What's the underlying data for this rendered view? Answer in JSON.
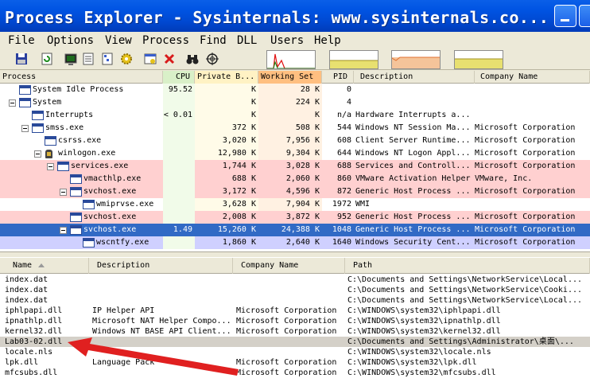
{
  "window": {
    "title": "Process Explorer - Sysinternals: www.sysinternals.co..."
  },
  "menu": [
    "File",
    "Options",
    "View",
    "Process",
    "Find",
    "DLL",
    "Users",
    "Help"
  ],
  "toolbar": {
    "icons": [
      "save-icon",
      "refresh-icon",
      "system-info-icon",
      "properties-icon",
      "tree-icon",
      "gear-icon",
      "window-target-icon",
      "kill-icon",
      "binoculars-icon",
      "crosshair-icon"
    ]
  },
  "process_list": {
    "columns": [
      "Process",
      "CPU",
      "Private B...",
      "Working Set",
      "PID",
      "Description",
      "Company Name"
    ],
    "rows": [
      {
        "name": "System Idle Process",
        "cpu": "95.52",
        "private": "K",
        "working": "28 K",
        "pid": "0",
        "desc": "",
        "company": "",
        "indent": 0,
        "tree": false,
        "bg": "#ffffff",
        "color": "#000000"
      },
      {
        "name": "System",
        "cpu": "",
        "private": "K",
        "working": "224 K",
        "pid": "4",
        "desc": "",
        "company": "",
        "indent": 0,
        "tree": true,
        "bg": "#ffffff",
        "color": "#000000"
      },
      {
        "name": "Interrupts",
        "cpu": "< 0.01",
        "private": "K",
        "working": "K",
        "pid": "n/a",
        "desc": "Hardware Interrupts a...",
        "company": "",
        "indent": 1,
        "tree": false,
        "bg": "#ffffff",
        "color": "#000000"
      },
      {
        "name": "smss.exe",
        "cpu": "",
        "private": "372 K",
        "working": "508 K",
        "pid": "544",
        "desc": "Windows NT Session Ma...",
        "company": "Microsoft Corporation",
        "indent": 1,
        "tree": true,
        "bg": "#ffffff",
        "color": "#000000"
      },
      {
        "name": "csrss.exe",
        "cpu": "",
        "private": "3,020 K",
        "working": "7,956 K",
        "pid": "608",
        "desc": "Client Server Runtime...",
        "company": "Microsoft Corporation",
        "indent": 2,
        "tree": false,
        "bg": "#ffffff",
        "color": "#000000"
      },
      {
        "name": "winlogon.exe",
        "cpu": "",
        "private": "12,980 K",
        "working": "9,304 K",
        "pid": "644",
        "desc": "Windows NT Logon Appl...",
        "company": "Microsoft Corporation",
        "indent": 2,
        "tree": true,
        "bg": "#ffffff",
        "color": "#000000",
        "win": true
      },
      {
        "name": "services.exe",
        "cpu": "",
        "private": "1,744 K",
        "working": "3,028 K",
        "pid": "688",
        "desc": "Services and Controll...",
        "company": "Microsoft Corporation",
        "indent": 3,
        "tree": true,
        "bg": "#ffd0d0",
        "color": "#000000"
      },
      {
        "name": "vmacthlp.exe",
        "cpu": "",
        "private": "688 K",
        "working": "2,060 K",
        "pid": "860",
        "desc": "VMware Activation Helper",
        "company": "VMware, Inc.",
        "indent": 4,
        "tree": false,
        "bg": "#ffd0d0",
        "color": "#000000"
      },
      {
        "name": "svchost.exe",
        "cpu": "",
        "private": "3,172 K",
        "working": "4,596 K",
        "pid": "872",
        "desc": "Generic Host Process ...",
        "company": "Microsoft Corporation",
        "indent": 4,
        "tree": true,
        "bg": "#ffd0d0",
        "color": "#000000"
      },
      {
        "name": "wmiprvse.exe",
        "cpu": "",
        "private": "3,628 K",
        "working": "7,904 K",
        "pid": "1972",
        "desc": "WMI",
        "company": "",
        "indent": 5,
        "tree": false,
        "bg": "#ffffff",
        "color": "#000000"
      },
      {
        "name": "svchost.exe",
        "cpu": "",
        "private": "2,008 K",
        "working": "3,872 K",
        "pid": "952",
        "desc": "Generic Host Process ...",
        "company": "Microsoft Corporation",
        "indent": 4,
        "tree": false,
        "bg": "#ffd0d0",
        "color": "#000000"
      },
      {
        "name": "svchost.exe",
        "cpu": "1.49",
        "private": "15,260 K",
        "working": "24,388 K",
        "pid": "1048",
        "desc": "Generic Host Process ...",
        "company": "Microsoft Corporation",
        "indent": 4,
        "tree": true,
        "bg": "#316ac5",
        "color": "#ffffff"
      },
      {
        "name": "wscntfy.exe",
        "cpu": "",
        "private": "1,860 K",
        "working": "2,640 K",
        "pid": "1640",
        "desc": "Windows Security Cent...",
        "company": "Microsoft Corporation",
        "indent": 5,
        "tree": false,
        "bg": "#cfd0ff",
        "color": "#000000"
      }
    ]
  },
  "dll_list": {
    "columns": [
      "Name",
      "Description",
      "Company Name",
      "Path"
    ],
    "rows": [
      {
        "name": "index.dat",
        "desc": "",
        "company": "",
        "path": "C:\\Documents and Settings\\NetworkService\\Local...",
        "highlight": false
      },
      {
        "name": "index.dat",
        "desc": "",
        "company": "",
        "path": "C:\\Documents and Settings\\NetworkService\\Cooki...",
        "highlight": false
      },
      {
        "name": "index.dat",
        "desc": "",
        "company": "",
        "path": "C:\\Documents and Settings\\NetworkService\\Local...",
        "highlight": false
      },
      {
        "name": "iphlpapi.dll",
        "desc": "IP Helper API",
        "company": "Microsoft Corporation",
        "path": "C:\\WINDOWS\\system32\\iphlpapi.dll",
        "highlight": false
      },
      {
        "name": "ipnathlp.dll",
        "desc": "Microsoft NAT Helper Compo...",
        "company": "Microsoft Corporation",
        "path": "C:\\WINDOWS\\system32\\ipnathlp.dll",
        "highlight": false
      },
      {
        "name": "kernel32.dll",
        "desc": "Windows NT BASE API Client...",
        "company": "Microsoft Corporation",
        "path": "C:\\WINDOWS\\system32\\kernel32.dll",
        "highlight": false
      },
      {
        "name": "Lab03-02.dll",
        "desc": "",
        "company": "",
        "path": "C:\\Documents and Settings\\Administrator\\桌面\\...",
        "highlight": true
      },
      {
        "name": "locale.nls",
        "desc": "",
        "company": "",
        "path": "C:\\WINDOWS\\system32\\locale.nls",
        "highlight": false
      },
      {
        "name": "lpk.dll",
        "desc": "Language Pack",
        "company": "Microsoft Corporation",
        "path": "C:\\WINDOWS\\system32\\lpk.dll",
        "highlight": false
      },
      {
        "name": "mfcsubs.dll",
        "desc": "",
        "company": "Microsoft Corporation",
        "path": "C:\\WINDOWS\\system32\\mfcsubs.dll",
        "highlight": false
      }
    ]
  },
  "colors": {
    "titlebar": "#0054e3",
    "selection": "#316ac5",
    "service_row": "#ffd0d0",
    "own_process_row": "#cfd0ff",
    "cpu_col_header": "#d9f0c8",
    "private_col_header": "#fff2c4",
    "working_col_header": "#ffbf80",
    "annotation_arrow": "#e02020"
  }
}
